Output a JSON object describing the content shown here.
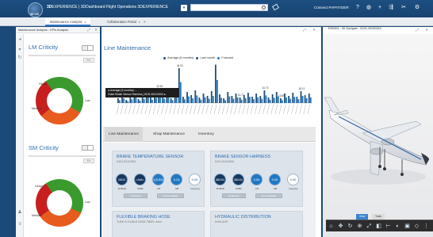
{
  "topbar": {
    "compass_label": "3D V.R",
    "app_title_prefix": "3D",
    "app_title_bold": "EXPERIENCE",
    "app_title_rest": " | 3DDashboard Flight Operations 3DEXPERIENCE",
    "search_placeholder": "",
    "user": "Connect PAPATIGER",
    "icons": [
      "help-icon",
      "info-icon",
      "add-icon",
      "share-icon",
      "settings-icon",
      "tools-icon"
    ]
  },
  "tabs": [
    {
      "label": "Maintenance Analysis",
      "active": true
    },
    {
      "label": "Collaboration Portal",
      "active": false
    }
  ],
  "left_panel": {
    "title": "Maintenance Analysis - KPIs Analysis",
    "widgets": [
      {
        "title": "LM Criticity",
        "filter_btn": "filter",
        "labels": {
          "heavy": "Heavy",
          "low": "Low",
          "medium": "Medium"
        }
      },
      {
        "title": "SM Criticity",
        "filter_btn": "filter",
        "labels": {
          "heavy": "Heavy",
          "low": "Low",
          "medium": "Medium"
        }
      }
    ]
  },
  "center_panel": {
    "title": "Line Maintenance",
    "legend": [
      {
        "label": "Average (6 months)",
        "color": "#1f4e79"
      },
      {
        "label": "Last month",
        "color": "#1f4e79"
      },
      {
        "label": "Forecast",
        "color": "#1f78c4"
      }
    ],
    "tooltip": {
      "line1": "● Average (6 months): ...",
      "line2": "Outer Brake Sensor Harness_N191-52413004 ●"
    },
    "subtabs": [
      "Line Maintenance",
      "Shop Maintenance",
      "Inventory"
    ],
    "cards": [
      {
        "title": "BRAKE TEMPERATURE SENSOR",
        "sub": "N191-52410500",
        "kpis": [
          {
            "value": "2802",
            "label": "MTBUR"
          },
          {
            "value": "<NA>",
            "label": "MTBF"
          },
          {
            "value": "1(5.55)",
            "label": "LM"
          },
          {
            "value": "3.13",
            "label": "SM"
          },
          {
            "value": "0.00",
            "label": "Inventory"
          }
        ],
        "btn1": "% Events",
        "btn2": "% Investigate"
      },
      {
        "title": "BRAKE SENSOR HARNESS",
        "sub": "N191-52413004",
        "kpis": [
          {
            "value": "38041",
            "label": "MTBUR"
          },
          {
            "value": "38041",
            "label": "MTBF"
          },
          {
            "value": "0.00",
            "label": "LM"
          },
          {
            "value": "0.00",
            "label": "SM"
          },
          {
            "value": "0.00",
            "label": "Inventory"
          }
        ],
        "btn1": "% Events",
        "btn2": "% Investigate"
      },
      {
        "title": "FLEXIBLE BRAKING HOSE",
        "sub": "TUBE-FLEXIBLE-HOSE-TBBFL-4mm"
      },
      {
        "title": "HYDRAULIC DISTRIBUTION",
        "sub": "DHM-UNIT"
      }
    ]
  },
  "chart_data": {
    "type": "bar",
    "title": "Line Maintenance",
    "series": [
      {
        "name": "Average (6 months)"
      },
      {
        "name": "Last month"
      },
      {
        "name": "Forecast"
      }
    ],
    "annotations": [
      "44.91",
      "36.75",
      "12.53",
      "14.73",
      "10.70",
      "13.89",
      "18.11"
    ]
  },
  "right_panel": {
    "title": "ER0304 - 3D Navigate - N191-00000063",
    "toolbar_tabs": [
      "View",
      "Tools"
    ]
  }
}
